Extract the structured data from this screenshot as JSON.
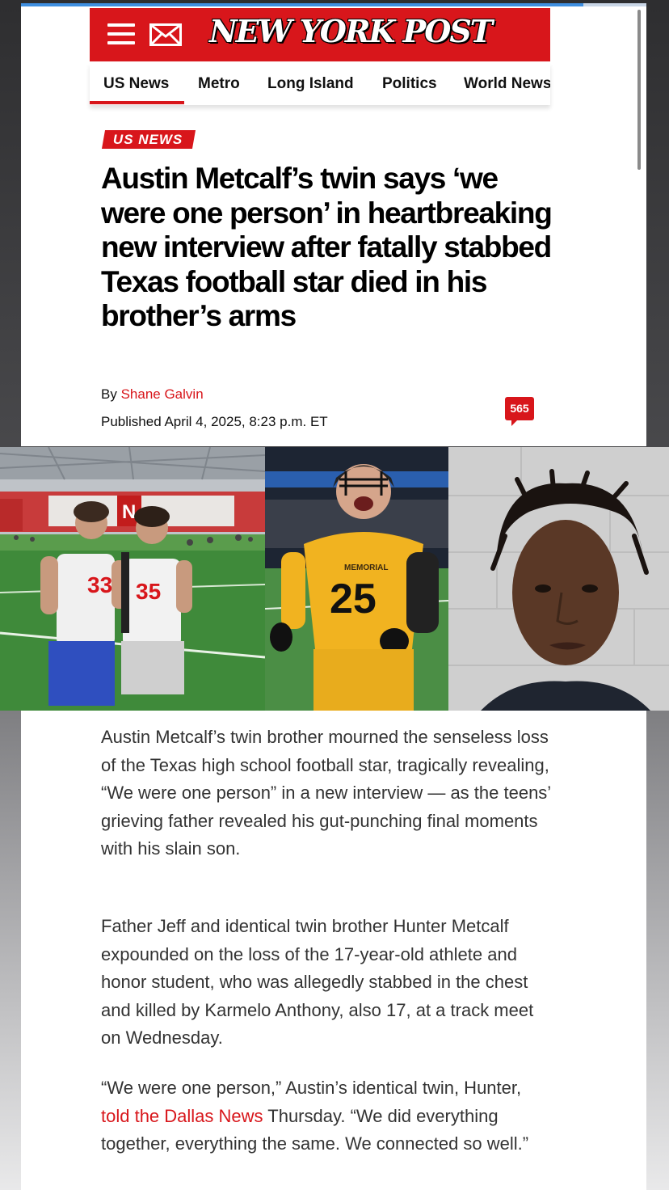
{
  "header": {
    "brand": "NEW YORK POST",
    "menu_icon": "hamburger-menu-icon",
    "mail_icon": "mail-icon",
    "colors": {
      "brand_red": "#d8161b"
    }
  },
  "nav": {
    "items": [
      {
        "label": "US News",
        "active": true
      },
      {
        "label": "Metro"
      },
      {
        "label": "Long Island"
      },
      {
        "label": "Politics"
      },
      {
        "label": "World News"
      }
    ]
  },
  "article": {
    "section": "US NEWS",
    "headline": "Austin Metcalf’s twin says ‘we were one person’ in heartbreaking new interview after fatally stabbed Texas football star died in his brother’s arms",
    "byline_prefix": "By",
    "author": "Shane Galvin",
    "published": "Published April 4, 2025, 8:23 p.m. ET",
    "comment_count": "565",
    "paragraphs": [
      {
        "text": "Austin Metcalf’s twin brother mourned the senseless loss of the Texas high school football star, tragically revealing, “We were one person” in a new interview — as the teens’ grieving father revealed his gut-punching final moments with his slain son."
      },
      {
        "text": "Father Jeff and identical twin brother Hunter Metcalf expounded on the loss of the 17-year-old athlete and honor student, who was allegedly stabbed in the chest and killed by Karmelo Anthony, also 17, at a track meet on Wednesday."
      }
    ],
    "quote_paragraph": {
      "before": "“We were one person,” Austin’s identical twin, Hunter,",
      "link": "told the Dallas News",
      "after": "Thursday. “We did everything together, everything the same. We connected so well.”"
    }
  },
  "photos": {
    "left": {
      "jersey_a": "33",
      "jersey_b": "35"
    },
    "middle": {
      "jersey": "25",
      "school": "MEMORIAL"
    }
  }
}
